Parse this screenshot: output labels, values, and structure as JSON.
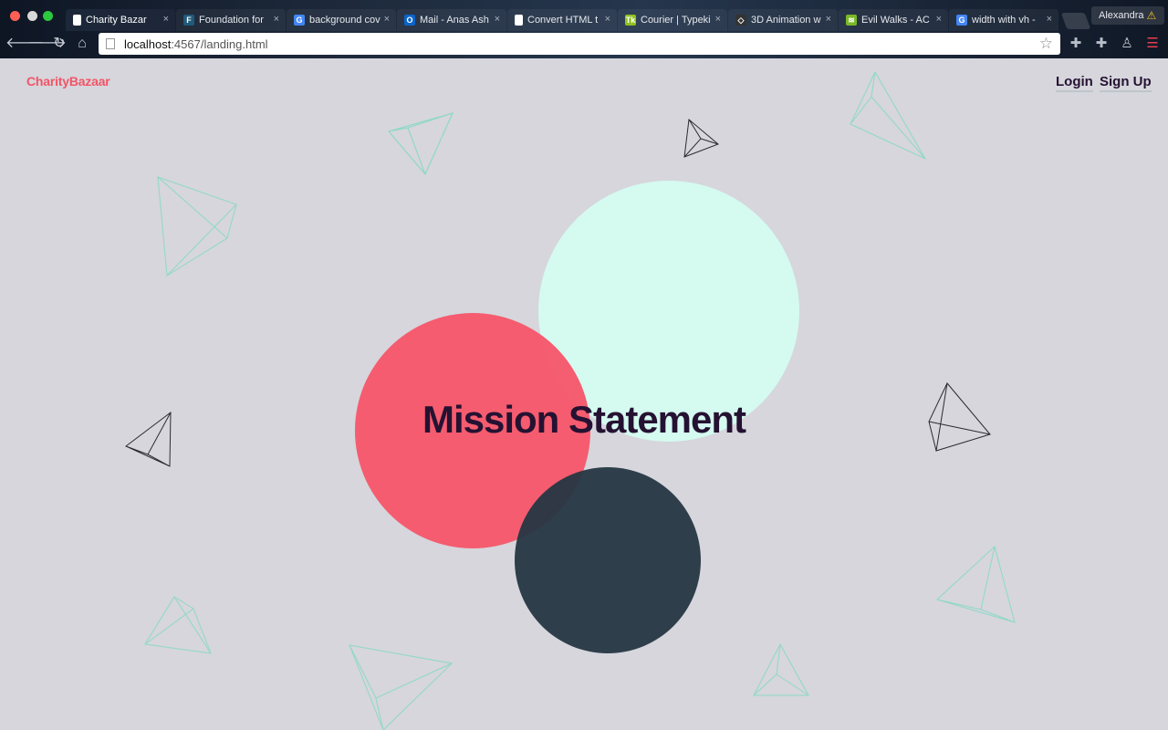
{
  "browser": {
    "tabs": [
      {
        "title": "Charity Bazar",
        "favicon": "page-icon",
        "active": true
      },
      {
        "title": "Foundation for",
        "favicon": "foundation-icon",
        "favicon_letter": "F",
        "favicon_color": "#1f5a7a"
      },
      {
        "title": "background cov",
        "favicon": "google-icon",
        "favicon_letter": "G",
        "favicon_color": "#4285f4"
      },
      {
        "title": "Mail - Anas Ash",
        "favicon": "outlook-icon",
        "favicon_letter": "O",
        "favicon_color": "#0a64c8"
      },
      {
        "title": "Convert HTML t",
        "favicon": "page-icon"
      },
      {
        "title": "Courier | Typeki",
        "favicon": "typekit-icon",
        "favicon_letter": "Tk",
        "favicon_color": "#8fc21f"
      },
      {
        "title": "3D Animation w",
        "favicon": "codepen-icon",
        "favicon_letter": "◇",
        "favicon_color": "#333333"
      },
      {
        "title": "Evil Walks - AC",
        "favicon": "spotify-icon",
        "favicon_letter": "≋",
        "favicon_color": "#7ab828"
      },
      {
        "title": "width with vh -",
        "favicon": "google-icon",
        "favicon_letter": "G",
        "favicon_color": "#4285f4"
      }
    ],
    "profile_name": "Alexandra",
    "url_host": "localhost",
    "url_rest": ":4567/landing.html",
    "tab_close_glyph": "×"
  },
  "page": {
    "brand": "CharityBazaar",
    "nav": {
      "login": "Login",
      "signup": "Sign Up"
    },
    "heading": "Mission Statement"
  },
  "colors": {
    "brand": "#f25566",
    "mint_circle": "#d5faf0",
    "red_circle": "#f6566a",
    "dark_circle": "#253642",
    "heading": "#251232",
    "background": "#d6d6dc"
  }
}
